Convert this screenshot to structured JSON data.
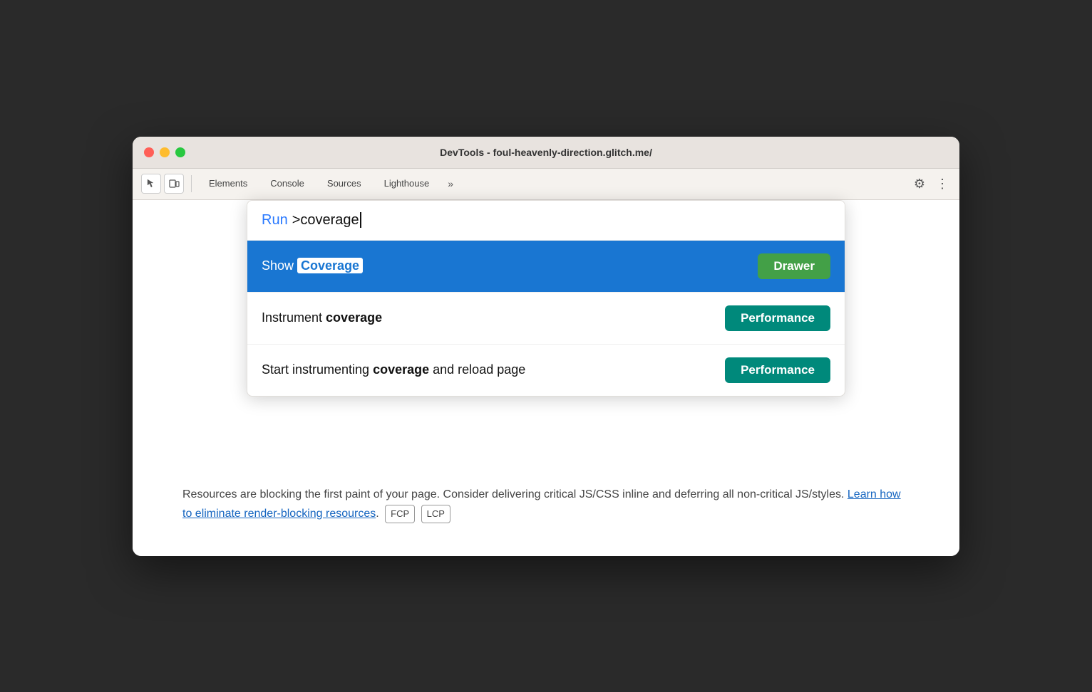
{
  "window": {
    "title": "DevTools - foul-heavenly-direction.glitch.me/"
  },
  "toolbar": {
    "tabs": [
      {
        "id": "elements",
        "label": "Elements"
      },
      {
        "id": "console",
        "label": "Console"
      },
      {
        "id": "sources",
        "label": "Sources"
      },
      {
        "id": "lighthouse",
        "label": "Lighthouse"
      }
    ],
    "more_label": "»",
    "settings_icon": "⚙",
    "more_icon": "⋮"
  },
  "command_palette": {
    "run_label": "Run",
    "input_text": ">coverage",
    "results": [
      {
        "id": "show-coverage",
        "prefix": "Show ",
        "highlight": "Coverage",
        "suffix": "",
        "tag_label": "Drawer",
        "tag_class": "tag-drawer",
        "active": true
      },
      {
        "id": "instrument-coverage",
        "prefix": "Instrument ",
        "bold": "coverage",
        "suffix": "",
        "tag_label": "Performance",
        "tag_class": "tag-performance",
        "active": false
      },
      {
        "id": "start-instrumenting",
        "prefix": "Start instrumenting ",
        "bold": "coverage",
        "suffix": " and reload page",
        "tag_label": "Performance",
        "tag_class": "tag-performance",
        "active": false
      }
    ]
  },
  "background": {
    "text_before_link": "Resources are blocking the first paint of your page. Consider delivering critical JS/CSS inline and deferring all non-critical JS/styles.",
    "link_text": "Learn how to eliminate render-blocking resources",
    "text_after_link": ".",
    "badges": [
      "FCP",
      "LCP"
    ]
  }
}
